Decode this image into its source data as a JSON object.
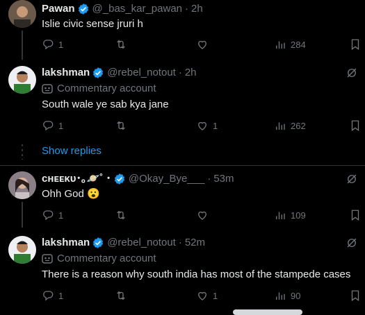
{
  "tweets": [
    {
      "name": "Pawan",
      "handle": "@_bas_kar_pawan",
      "time": "2h",
      "text": "Islie civic sense jruri h",
      "replies": "1",
      "likes": "",
      "views": "284"
    },
    {
      "name": "lakshman",
      "handle": "@rebel_notout",
      "time": "2h",
      "badge": "Commentary account",
      "text": "South wale ye sab kya jane",
      "replies": "1",
      "likes": "1",
      "views": "262"
    },
    {
      "name": "cʜᴇᴇᴋᴜ･｡🪐˚ ･",
      "handle": "@Okay_Bye___",
      "time": "53m",
      "text": "Ohh God 😮",
      "replies": "1",
      "likes": "",
      "views": "109"
    },
    {
      "name": "lakshman",
      "handle": "@rebel_notout",
      "time": "52m",
      "badge": "Commentary account",
      "text": "There is a reason why south india has most of the stampede cases",
      "replies": "1",
      "likes": "1",
      "views": "90"
    }
  ],
  "show_replies_label": "Show replies",
  "separator": "·",
  "icons": [
    "verified-badge-icon",
    "reply-icon",
    "retweet-icon",
    "like-icon",
    "views-icon",
    "bookmark-icon",
    "grok-icon",
    "commentary-badge-icon"
  ],
  "colors": {
    "link": "#1d9bf0",
    "muted": "#71767b",
    "text": "#e7e9ea",
    "background": "#000000"
  }
}
